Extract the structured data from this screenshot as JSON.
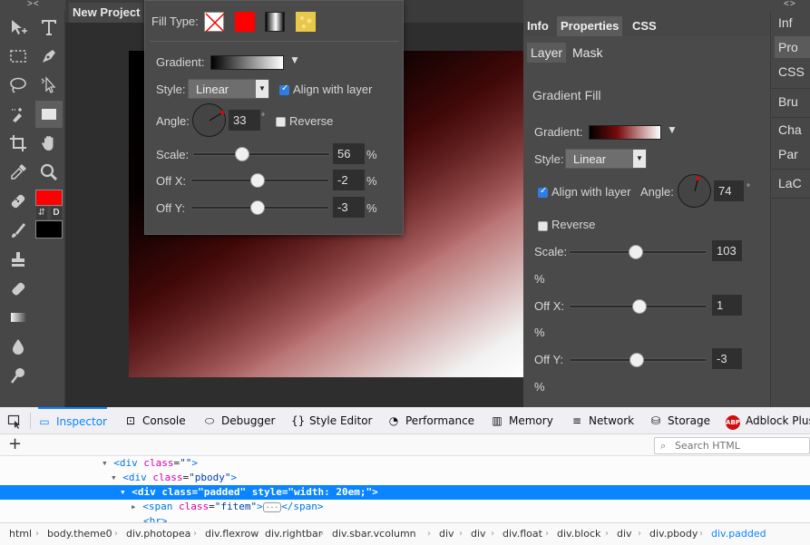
{
  "window": {
    "doc_tab": "New Project"
  },
  "top_arrows": {
    "left": "><",
    "right": "<>"
  },
  "toolbar": {
    "tools": [
      "move-tool",
      "type-tool",
      "marquee-tool",
      "pen-tool",
      "lasso-tool",
      "direct-select-tool",
      "quick-select-tool",
      "shape-tool",
      "crop-tool",
      "hand-tool",
      "eyedropper-tool",
      "zoom-tool",
      "healing-tool",
      "brush-tool",
      "stamp-tool",
      "eraser-tool",
      "gradient-tool",
      "blur-tool",
      "dodge-tool"
    ],
    "fg_color": "#ff0000",
    "bg_color": "#000000",
    "swap_label": "⇵",
    "default_label": "D"
  },
  "fill_popup": {
    "fill_type_label": "Fill Type:",
    "gradient_label": "Gradient:",
    "style_label": "Style:",
    "style_value": "Linear",
    "align_label": "Align with layer",
    "align_checked": true,
    "angle_label": "Angle:",
    "angle_value": "33",
    "degree": "°",
    "reverse_label": "Reverse",
    "reverse_checked": false,
    "scale_label": "Scale:",
    "scale_value": "56",
    "offx_label": "Off X:",
    "offx_value": "-2",
    "offy_label": "Off Y:",
    "offy_value": "-3",
    "percent": "%"
  },
  "props_panel": {
    "tabs": [
      "Info",
      "Properties",
      "CSS"
    ],
    "subtabs": [
      "Layer",
      "Mask"
    ],
    "section_title": "Gradient Fill",
    "gradient_label": "Gradient:",
    "style_label": "Style:",
    "style_value": "Linear",
    "align_label": "Align with layer",
    "angle_label": "Angle:",
    "angle_value": "74",
    "degree": "°",
    "reverse_label": "Reverse",
    "scale_label": "Scale:",
    "scale_value": "103",
    "offx_label": "Off X:",
    "offx_value": "1",
    "offy_label": "Off Y:",
    "offy_value": "-3",
    "percent": "%"
  },
  "far_panel": {
    "items": [
      "Inf",
      "Pro",
      "CSS",
      "Bru",
      "Cha",
      "Par",
      "LaC"
    ]
  },
  "devtools": {
    "tabs": [
      "Inspector",
      "Console",
      "Debugger",
      "Style Editor",
      "Performance",
      "Memory",
      "Network",
      "Storage",
      "Adblock Plus"
    ],
    "active_tab": "Inspector",
    "plus": "+",
    "search_placeholder": "Search HTML",
    "code": [
      {
        "tag": "div",
        "attr": "class",
        "val": "\"\""
      },
      {
        "tag": "div",
        "attr": "class",
        "val": "\"pbody\""
      },
      {
        "text": "<div class=\"padded\" style=\"width: 20em;\">"
      },
      {
        "tag": "span",
        "attr": "class",
        "val": "\"fitem\"",
        "tail": "</span>"
      },
      {
        "text": "<hr>"
      }
    ],
    "breadcrumbs": [
      "html",
      "body.theme0",
      "div.photopea",
      "div.flexrow",
      "div.rightbar",
      "div.sbar.vcolumn",
      "div",
      "div",
      "div.float",
      "div.block",
      "div",
      "div.pbody",
      "div.padded"
    ]
  }
}
